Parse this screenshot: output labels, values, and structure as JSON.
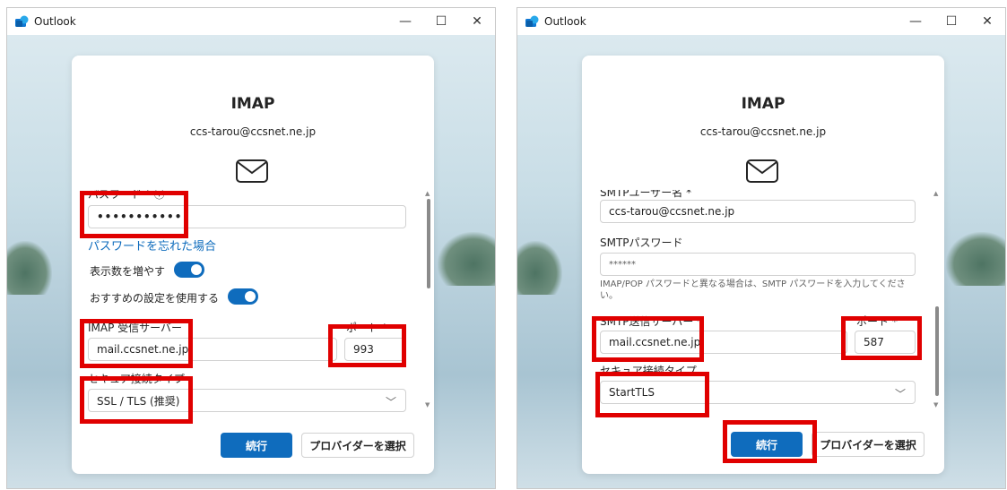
{
  "colors": {
    "accent": "#0f6cbd",
    "highlight": "#e00000"
  },
  "icons": {
    "app": "outlook-icon",
    "mail": "envelope-icon",
    "minimize": "minimize-icon",
    "maximize": "maximize-icon",
    "close": "close-icon",
    "chevron": "chevron-down-icon"
  },
  "left": {
    "window_title": "Outlook",
    "controls": {
      "minimize": "—",
      "maximize": "☐",
      "close": "✕"
    },
    "title": "IMAP",
    "email": "ccs-tarou@ccsnet.ne.jp",
    "password_label": "パスワード * ⓘ",
    "password_value": "••••••••••••",
    "forgot_password": "パスワードを忘れた場合",
    "show_more": "表示数を増やす",
    "recommended": "おすすめの設定を使用する",
    "imap_server_label": "IMAP 受信サーバー",
    "port_label": "ポート *",
    "imap_server_value": "mail.ccsnet.ne.jp",
    "port_value": "993",
    "security_label": "セキュア接続タイプ",
    "security_value": "SSL / TLS (推奨)",
    "continue": "続行",
    "choose_provider": "プロバイダーを選択"
  },
  "right": {
    "window_title": "Outlook",
    "controls": {
      "minimize": "—",
      "maximize": "☐",
      "close": "✕"
    },
    "title": "IMAP",
    "email": "ccs-tarou@ccsnet.ne.jp",
    "smtp_user_label": "SMTPユーザー名 *",
    "smtp_user_value": "ccs-tarou@ccsnet.ne.jp",
    "smtp_password_label": "SMTPパスワード",
    "smtp_password_value": "******",
    "smtp_password_hint": "IMAP/POP パスワードと異なる場合は、SMTP パスワードを入力してください。",
    "smtp_server_label": "SMTP送信サーバー *",
    "port_label": "ポート *",
    "smtp_server_value": "mail.ccsnet.ne.jp",
    "port_value": "587",
    "security_label": "セキュア接続タイプ",
    "security_value": "StartTLS",
    "continue": "続行",
    "choose_provider": "プロバイダーを選択"
  }
}
